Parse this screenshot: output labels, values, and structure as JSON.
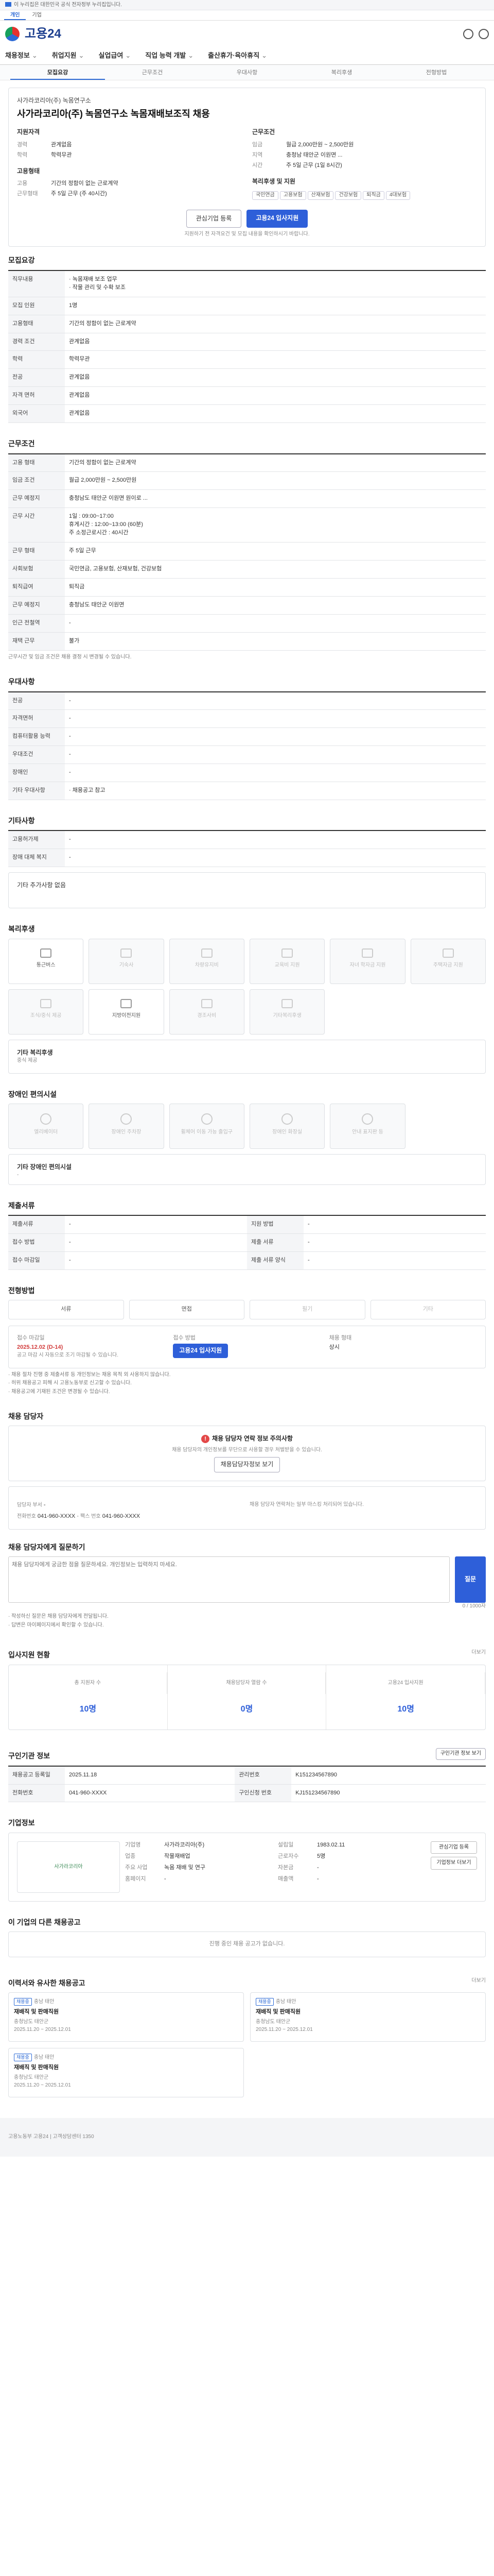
{
  "topbar": {
    "notice": "이 누리집은 대한민국 공식 전자정부 누리집입니다."
  },
  "site_tabs": [
    "개인",
    "기업"
  ],
  "logo": "고용24",
  "gnb": [
    "채용정보",
    "취업지원",
    "실업급여",
    "직업 능력 개발",
    "출산휴가·육아휴직"
  ],
  "subtabs": [
    "모집요강",
    "근무조건",
    "우대사항",
    "복리후생",
    "전형방법"
  ],
  "job": {
    "company": "사가라코리아(주) 녹몸연구소",
    "title": "사가라코리아(주) 녹몸연구소 녹몸재배보조직 채용",
    "left_head": "지원자격",
    "left": [
      [
        "경력",
        "관계없음"
      ],
      [
        "학력",
        "학력무관"
      ]
    ],
    "right_head": "근무조건",
    "right": [
      [
        "임금",
        "월급 2,000만원 ~ 2,500만원"
      ],
      [
        "지역",
        "충청남 태안군 이원면 ..."
      ],
      [
        "시간",
        "주 5일 근무 (1일 8시간)"
      ]
    ],
    "left2_head": "고용형태",
    "left2": [
      [
        "고용",
        "기간의 정함이 없는 근로계약"
      ],
      [
        "근무형태",
        "주 5일 근무 (주 40시간)"
      ]
    ],
    "right2_head": "복리후생 및 지원",
    "tags": [
      "국민연금",
      "고용보험",
      "산재보험",
      "건강보험",
      "퇴직금",
      "4대보험"
    ],
    "btn_interest": "관심기업 등록",
    "btn_apply": "고용24 입사지원",
    "note": "지원하기 전 자격요건 및 모집 내용을 확인하시기 바랍니다."
  },
  "recruit": {
    "title": "모집요강",
    "rows": [
      [
        "직무내용",
        "· 녹몸재배 보조 업무\n· 작물 관리 및 수확 보조"
      ],
      [
        "모집 인원",
        "1명"
      ],
      [
        "고용형태",
        "기간의 정함이 없는 근로계약"
      ],
      [
        "경력 조건",
        "관계없음"
      ],
      [
        "학력",
        "학력무관"
      ],
      [
        "전공",
        "관계없음"
      ],
      [
        "자격 면허",
        "관계없음"
      ],
      [
        "외국어",
        "관계없음"
      ]
    ]
  },
  "work": {
    "title": "근무조건",
    "rows": [
      [
        "고용 형태",
        "기간의 정함이 없는 근로계약"
      ],
      [
        "임금 조건",
        "월급 2,000만원 ~ 2,500만원"
      ],
      [
        "근무 예정지",
        "충청남도 태안군 이원면 원이로 ..."
      ],
      [
        "근무 시간",
        "1일 : 09:00~17:00\n휴게시간 : 12:00~13:00 (60분)\n주 소정근로시간 : 40시간"
      ],
      [
        "근무 형태",
        "주 5일 근무"
      ],
      [
        "사회보험",
        "국민연금, 고용보험, 산재보험, 건강보험"
      ],
      [
        "퇴직급여",
        "퇴직금"
      ],
      [
        "근무 예정지",
        "충청남도 태안군 이원면"
      ],
      [
        "인근 전철역",
        "-"
      ],
      [
        "재택 근무",
        "불가"
      ]
    ],
    "note": "근무시간 및 임금 조건은 채용 결정 시 변경될 수 있습니다."
  },
  "pref": {
    "title": "우대사항",
    "rows": [
      [
        "전공",
        "-"
      ],
      [
        "자격면허",
        "-"
      ],
      [
        "컴퓨터활용 능력",
        "-"
      ],
      [
        "우대조건",
        "-"
      ],
      [
        "장애인",
        "-"
      ],
      [
        "기타 우대사항",
        "· 채용공고 참고"
      ]
    ]
  },
  "etc": {
    "title": "기타사항",
    "rows": [
      [
        "고용허가제",
        "-"
      ],
      [
        "장애 대체 복지",
        "-"
      ]
    ],
    "extra": "기타 추가사항 없음"
  },
  "welfare": {
    "title": "복리후생",
    "items": [
      [
        "통근버스",
        true
      ],
      [
        "기숙사",
        false
      ],
      [
        "차량유지비",
        false
      ],
      [
        "교육비 지원",
        false
      ],
      [
        "자녀 학자금 지원",
        false
      ],
      [
        "주택자금 지원",
        false
      ],
      [
        "조식/중식 제공",
        false
      ],
      [
        "지방이전지원",
        true
      ],
      [
        "경조사비",
        false
      ],
      [
        "기타복리후생",
        false
      ]
    ],
    "extra_label": "기타 복리후생",
    "extra": "중식 제공"
  },
  "facility": {
    "title": "장애인 편의시설",
    "items": [
      "엘리베이터",
      "장애인 주차장",
      "휠체어 이동 가능 출입구",
      "장애인 화장실",
      "안내 표지판 등"
    ],
    "extra_label": "기타 장애인 편의시설",
    "extra": "-"
  },
  "submit": {
    "title": "제출서류",
    "rows": [
      [
        "제출서류",
        "-",
        "지원 방법",
        "-"
      ],
      [
        "접수 방법",
        "-",
        "제출 서류",
        "-"
      ],
      [
        "접수 마감일",
        "-",
        "제출 서류 양식",
        "-"
      ]
    ]
  },
  "process": {
    "title": "전형방법",
    "steps": [
      [
        "서류",
        true
      ],
      [
        "면접",
        true
      ],
      [
        "필기",
        false
      ],
      [
        "기타",
        false
      ]
    ],
    "deadline_label": "접수 마감일",
    "deadline": "2025.12.02 (D-14)",
    "deadline_note": "공고 마감 시 자동으로 조기 마감될 수 있습니다.",
    "apply_label": "접수 방법",
    "apply": "고용24 입사지원",
    "type_label": "채용 형태",
    "type": "상시",
    "notices": [
      "· 채용 절차 진행 중 제출서류 등 개인정보는 채용 목적 외 사용하지 않습니다.",
      "· 허위 채용공고 피해 시 고용노동부로 신고할 수 있습니다.",
      "· 채용공고에 기재된 조건은 변경될 수 있습니다."
    ]
  },
  "manager": {
    "title": "채용 담당자",
    "warn": "채용 담당자 연락 정보 주의사항",
    "warn_text": "채용 담당자의 개인정보를 무단으로 사용할 경우 처벌받을 수 있습니다.",
    "btn": "채용담당자정보 보기",
    "name_label": "담당자 부서",
    "name": "-",
    "tel_label": "전화번호",
    "tel": "041-960-XXXX",
    "fax_label": "팩스 번호",
    "fax": "041-960-XXXX",
    "info": "채용 담당자 연락처는 일부 마스킹 처리되어 있습니다."
  },
  "qna": {
    "title": "채용 담당자에게 질문하기",
    "placeholder": "채용 담당자에게 궁금한 점을 질문하세요. 개인정보는 입력하지 마세요.",
    "btn": "질문",
    "count": "0 / 1000자",
    "notes": [
      "· 작성하신 질문은 채용 담당자에게 전달됩니다.",
      "· 답변은 마이페이지에서 확인할 수 있습니다."
    ]
  },
  "status": {
    "title": "입사지원 현황",
    "more": "더보기",
    "items": [
      [
        "총 지원자 수",
        "10명"
      ],
      [
        "채용담당자 열람 수",
        "0명"
      ],
      [
        "고용24 입사지원",
        "10명"
      ]
    ]
  },
  "reg": {
    "title": "구인기관 정보",
    "rows": [
      [
        "채용공고 등록일",
        "2025.11.18",
        "관리번호",
        "K151234567890"
      ],
      [
        "전화번호",
        "041-960-XXXX",
        "구인신청 번호",
        "KJ151234567890"
      ]
    ],
    "btn": "구인기관 정보 보기"
  },
  "company": {
    "title": "기업정보",
    "logo_text": "사가라코리아",
    "rows": [
      [
        "기업명",
        "사가라코리아(주)"
      ],
      [
        "업종",
        "작물재배업"
      ],
      [
        "주요 사업",
        "녹몸 재배 및 연구"
      ],
      [
        "홈페이지",
        "-"
      ]
    ],
    "rows2": [
      [
        "설립일",
        "1983.02.11"
      ],
      [
        "근로자수",
        "5명"
      ],
      [
        "자본금",
        "-"
      ],
      [
        "매출액",
        "-"
      ]
    ],
    "btns": [
      "관심기업 등록",
      "기업정보 더보기"
    ]
  },
  "others": {
    "title": "이 기업의 다른 채용공고",
    "empty": "진행 중인 채용 공고가 없습니다."
  },
  "recommend": {
    "title": "이력서와 유사한 채용공고",
    "more": "더보기",
    "cards": [
      [
        "채용중",
        "충남 태안",
        "재배직 및 판매직원",
        "충청남도 태안군",
        "2025.11.20 ~ 2025.12.01"
      ],
      [
        "채용중",
        "충남 태안",
        "재배직 및 판매직원",
        "충청남도 태안군",
        "2025.11.20 ~ 2025.12.01"
      ],
      [
        "채용중",
        "충남 태안",
        "재배직 및 판매직원",
        "충청남도 태안군",
        "2025.11.20 ~ 2025.12.01"
      ]
    ]
  },
  "footer": {
    "text": "고용노동부 고용24 | 고객상담센터 1350"
  }
}
